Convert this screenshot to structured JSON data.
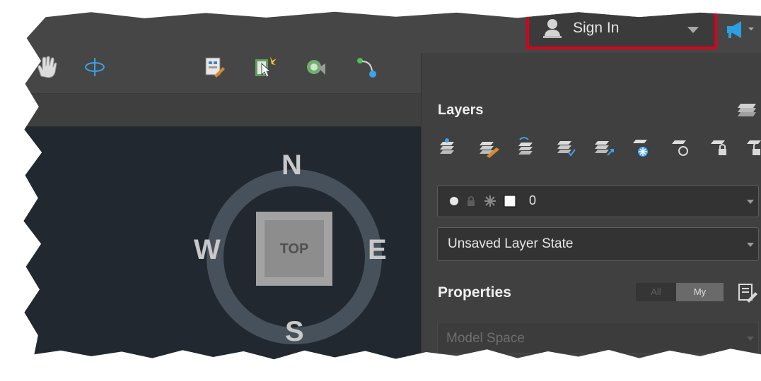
{
  "header": {
    "sign_in_label": "Sign In",
    "icons": [
      "user-icon",
      "chevron-down-icon",
      "communication-center-icon"
    ]
  },
  "toolbar": {
    "icons": [
      "pan-hand-icon",
      "orbit-icon",
      "block-editor-icon",
      "select-object-icon",
      "match-properties-icon",
      "connect-nodes-icon"
    ]
  },
  "compass": {
    "north": "N",
    "south": "S",
    "east": "E",
    "west": "W",
    "view_cube_label": "TOP"
  },
  "layers_panel": {
    "title": "Layers",
    "tool_icons": [
      "layer-properties-icon",
      "match-layer-icon",
      "previous-layer-icon",
      "layer-isolate-icon",
      "make-current-layer-icon",
      "freeze-layer-icon",
      "turn-off-layer-icon",
      "lock-layer-icon",
      "unlock-layer-icon"
    ],
    "current_layer": {
      "name": "0",
      "status_icons": [
        "on-bulb-icon",
        "lock-icon",
        "freeze-sun-icon",
        "color-swatch-icon"
      ]
    },
    "layer_state": "Unsaved Layer State"
  },
  "properties_panel": {
    "title": "Properties",
    "toggle_all": "All",
    "toggle_my": "My",
    "space_selector": "Model Space"
  },
  "colors": {
    "highlight": "#d9001b",
    "viewport_bg": "#212830",
    "panel_bg": "#404040"
  }
}
